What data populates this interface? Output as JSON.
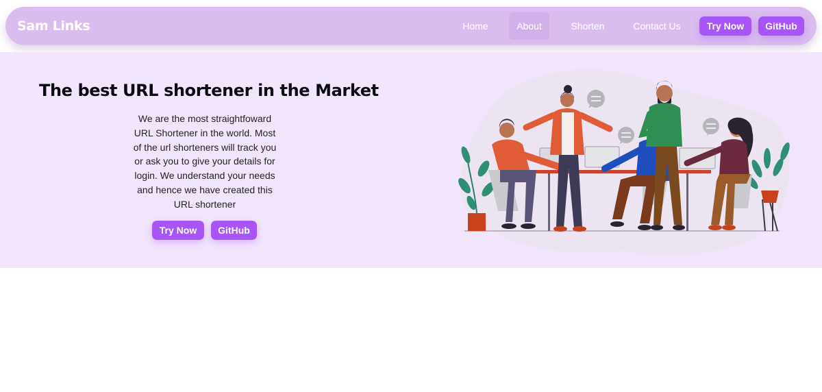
{
  "navbar": {
    "brand": "Sam Links",
    "links": [
      {
        "label": "Home",
        "active": false
      },
      {
        "label": "About",
        "active": true
      },
      {
        "label": "Shorten",
        "active": false
      },
      {
        "label": "Contact Us",
        "active": false
      }
    ],
    "try_now_label": "Try Now",
    "github_label": "GitHub"
  },
  "hero": {
    "title": "The best URL shortener in the Market",
    "description": "We are the most straightfoward URL Shortener in the world. Most of the url shorteners will track you or ask you to give your details for login. We understand your needs and hence we have created this URL shortener",
    "try_now_label": "Try Now",
    "github_label": "GitHub"
  },
  "colors": {
    "navbar_bg": "#d9bdee",
    "hero_bg": "#f2e6fd",
    "accent": "#a855f7"
  },
  "icons": {
    "illustration": "team-meeting-illustration"
  }
}
